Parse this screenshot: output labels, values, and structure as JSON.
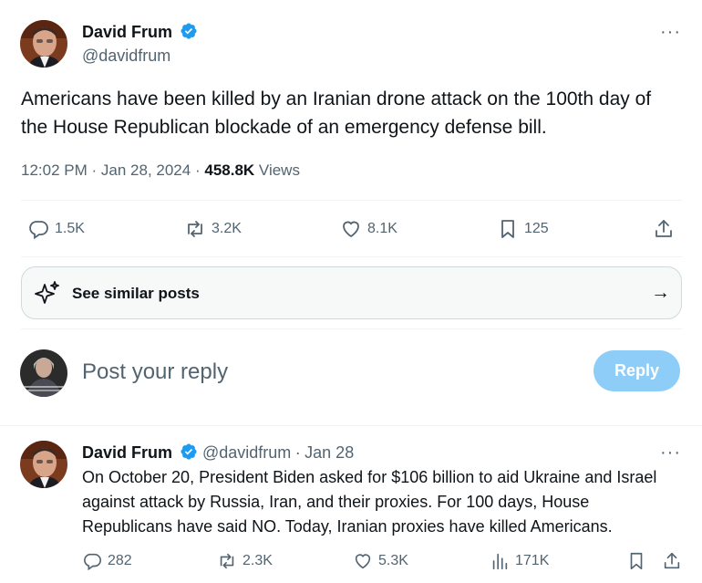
{
  "main_tweet": {
    "author_name": "David Frum",
    "author_handle": "@davidfrum",
    "more_label": "···",
    "text": "Americans have been killed by an Iranian drone attack on the 100th day of the House Republican blockade of an emergency defense bill.",
    "time": "12:02 PM",
    "date": "Jan 28, 2024",
    "views_count": "458.8K",
    "views_label": "Views",
    "separator": "·",
    "actions": {
      "replies": "1.5K",
      "retweets": "3.2K",
      "likes": "8.1K",
      "bookmarks": "125"
    }
  },
  "similar": {
    "label": "See similar posts",
    "arrow": "→"
  },
  "reply_box": {
    "placeholder": "Post your reply",
    "button_label": "Reply"
  },
  "second_tweet": {
    "author_name": "David Frum",
    "author_handle": "@davidfrum",
    "date": "Jan 28",
    "separator": "·",
    "more_label": "···",
    "text": "On October 20, President Biden asked for $106 billion to aid Ukraine and Israel against attack by Russia, Iran, and their proxies. For 100 days, House Republicans have said NO. Today, Iranian proxies have killed Americans.",
    "actions": {
      "replies": "282",
      "retweets": "2.3K",
      "likes": "5.3K",
      "views": "171K"
    }
  },
  "colors": {
    "verified_blue": "#1d9bf0",
    "reply_button": "#8ecdf8",
    "text_secondary": "#536471"
  }
}
